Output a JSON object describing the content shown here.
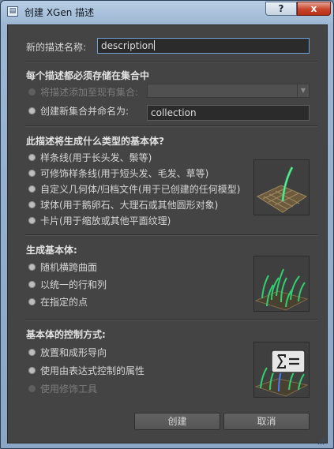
{
  "window": {
    "title": "创建 XGen 描述",
    "app_icon": "xgen-window-icon",
    "help_label": "?",
    "close_label": "x"
  },
  "name_row": {
    "label": "新的描述名称:",
    "value": "description"
  },
  "collection_section": {
    "header": "每个描述都必须存储在集合中",
    "options": [
      {
        "label": "将描述添加至现有集合:",
        "enabled": false
      },
      {
        "label": "创建新集合并命名为:",
        "enabled": true
      }
    ],
    "existing_collection": "",
    "new_collection_name": "collection"
  },
  "primitive_type_section": {
    "header": "此描述将生成什么类型的基本体?",
    "options": [
      {
        "label": "样条线(用于长头发、鬃等)"
      },
      {
        "label": "可修饰样条线(用于短头发、毛发、草等)"
      },
      {
        "label": "自定义几何体/归档文件(用于已创建的任何模型)"
      },
      {
        "label": "球体(用于鹅卵石、大理石或其他圆形对象)"
      },
      {
        "label": "卡片(用于缩放或其他平面纹理)"
      }
    ],
    "thumbnail": "spline-thumbnail"
  },
  "generate_section": {
    "header": "生成基本体:",
    "options": [
      {
        "label": "随机横跨曲面"
      },
      {
        "label": "以统一的行和列"
      },
      {
        "label": "在指定的点"
      }
    ],
    "thumbnail": "random-distribution-thumbnail"
  },
  "control_section": {
    "header": "基本体的控制方式:",
    "options": [
      {
        "label": "放置和成形导向",
        "enabled": true
      },
      {
        "label": "使用由表达式控制的属性",
        "enabled": true
      },
      {
        "label": "使用修饰工具",
        "enabled": false
      }
    ],
    "thumbnail": "expression-thumbnail"
  },
  "buttons": {
    "create": "创建",
    "cancel": "取消"
  }
}
